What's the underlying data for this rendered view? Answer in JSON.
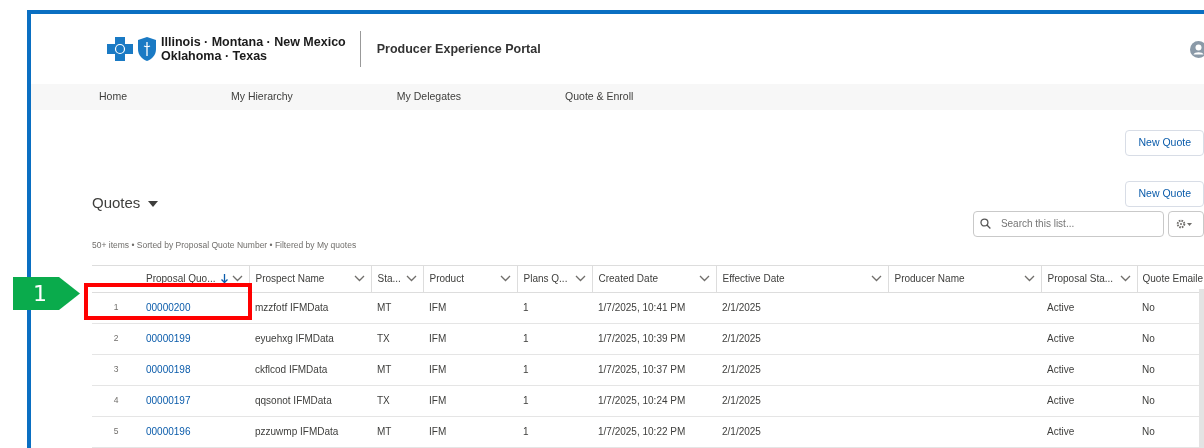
{
  "header": {
    "brand_lines": [
      "Illinois · Montana · New Mexico",
      "Oklahoma · Texas"
    ],
    "portal_title": "Producer Experience Portal"
  },
  "nav": [
    {
      "label": "Home"
    },
    {
      "label": "My Hierarchy"
    },
    {
      "label": "My Delegates"
    },
    {
      "label": "Quote & Enroll"
    }
  ],
  "page_button": "New Quote",
  "list": {
    "title": "Quotes",
    "summary": "50+ items • Sorted by Proposal Quote Number • Filtered by My quotes",
    "new_button": "New Quote",
    "search": {
      "placeholder": "Search this list..."
    }
  },
  "table": {
    "columns": [
      {
        "label": "Proposal Quo...",
        "sorted": true
      },
      {
        "label": "Prospect Name",
        "sorted": false
      },
      {
        "label": "Sta...",
        "sorted": false
      },
      {
        "label": "Product",
        "sorted": false
      },
      {
        "label": "Plans Q...",
        "sorted": false
      },
      {
        "label": "Created Date",
        "sorted": false
      },
      {
        "label": "Effective Date",
        "sorted": false
      },
      {
        "label": "Producer Name",
        "sorted": false
      },
      {
        "label": "Proposal Sta...",
        "sorted": false
      },
      {
        "label": "Quote Emaile",
        "sorted": false
      }
    ],
    "rows": [
      {
        "index": "1",
        "cells": [
          "00000200",
          "mzzfotf IFMData",
          "MT",
          "IFM",
          "1",
          "1/7/2025, 10:41 PM",
          "2/1/2025",
          "",
          "Active",
          "No"
        ]
      },
      {
        "index": "2",
        "cells": [
          "00000199",
          "eyuehxg IFMData",
          "TX",
          "IFM",
          "1",
          "1/7/2025, 10:39 PM",
          "2/1/2025",
          "",
          "Active",
          "No"
        ]
      },
      {
        "index": "3",
        "cells": [
          "00000198",
          "ckflcod IFMData",
          "MT",
          "IFM",
          "1",
          "1/7/2025, 10:37 PM",
          "2/1/2025",
          "",
          "Active",
          "No"
        ]
      },
      {
        "index": "4",
        "cells": [
          "00000197",
          "qqsonot IFMData",
          "TX",
          "IFM",
          "1",
          "1/7/2025, 10:24 PM",
          "2/1/2025",
          "",
          "Active",
          "No"
        ]
      },
      {
        "index": "5",
        "cells": [
          "00000196",
          "pzzuwmp IFMData",
          "MT",
          "IFM",
          "1",
          "1/7/2025, 10:22 PM",
          "2/1/2025",
          "",
          "Active",
          "No"
        ]
      }
    ]
  },
  "callout": {
    "label": "1"
  }
}
